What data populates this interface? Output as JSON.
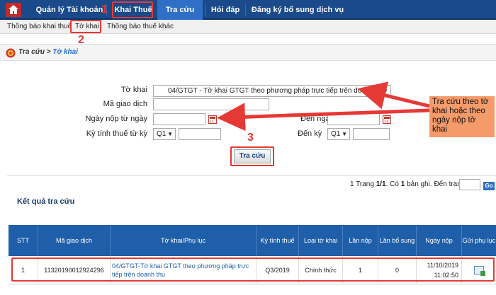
{
  "topnav": {
    "items": [
      "Quản lý Tài khoản",
      "Khai Thuế",
      "Tra cứu",
      "Hỏi đáp",
      "Đăng ký bổ sung dịch vụ"
    ]
  },
  "subnav": {
    "items": [
      "Thông báo khai thuế",
      "Tờ khai",
      "Thông báo thuế khác"
    ]
  },
  "annotations": {
    "step1": "1",
    "step2": "2",
    "step3": "3",
    "callout": "Tra cứu theo tờ khai hoặc theo ngày nộp tờ khai"
  },
  "breadcrumb": {
    "root": "Tra cứu",
    "sep": " > ",
    "current": "Tờ khai"
  },
  "form": {
    "to_khai_label": "Tờ khai",
    "to_khai_value": "04/GTGT - Tờ khai GTGT theo phương pháp trực tiếp trên doanh thu",
    "ma_giao_dich_label": "Mã giao dịch",
    "ngay_nop_tu_label": "Ngày nộp từ ngày",
    "den_ngay_label": "Đến ngày",
    "ky_tinh_thue_tu_label": "Kỳ tính thuế từ kỳ",
    "ky_tu_value": "Q1",
    "den_ky_label": "Đến kỳ",
    "ky_den_value": "Q1",
    "search_button": "Tra cứu"
  },
  "pager": {
    "text_1": "1  Trang ",
    "page": "1/1",
    "text_2": ". Có ",
    "count": "1",
    "text_3": " bản ghi. Đến trang",
    "go": "Go"
  },
  "results": {
    "title": "Kết quả tra cứu",
    "headers": [
      "STT",
      "Mã giao dịch",
      "Tờ khai/Phụ lục",
      "Kỳ tính thuế",
      "Loại tờ khai",
      "Lần nộp",
      "Lần bổ sung",
      "Ngày nộp",
      "Gửi phụ lục"
    ],
    "row": {
      "stt": "1",
      "ma_giao_dich": "11320190012924296",
      "to_khai": "04/GTGT-Tờ khai GTGT theo phương pháp trực tiếp trên doanh thu",
      "ky_tinh_thue": "Q3/2019",
      "loai_to_khai": "Chính thức",
      "lan_nop": "1",
      "lan_bo_sung": "0",
      "ngay_nop_date": "11/10/2019",
      "ngay_nop_time": "11:02:50"
    }
  },
  "colors": {
    "nav_bg": "#1a4a8a",
    "nav_active": "#2f6fc6",
    "annotation_red": "#e53935",
    "callout_bg": "#f59a6a",
    "table_header": "#1f5ea8"
  }
}
